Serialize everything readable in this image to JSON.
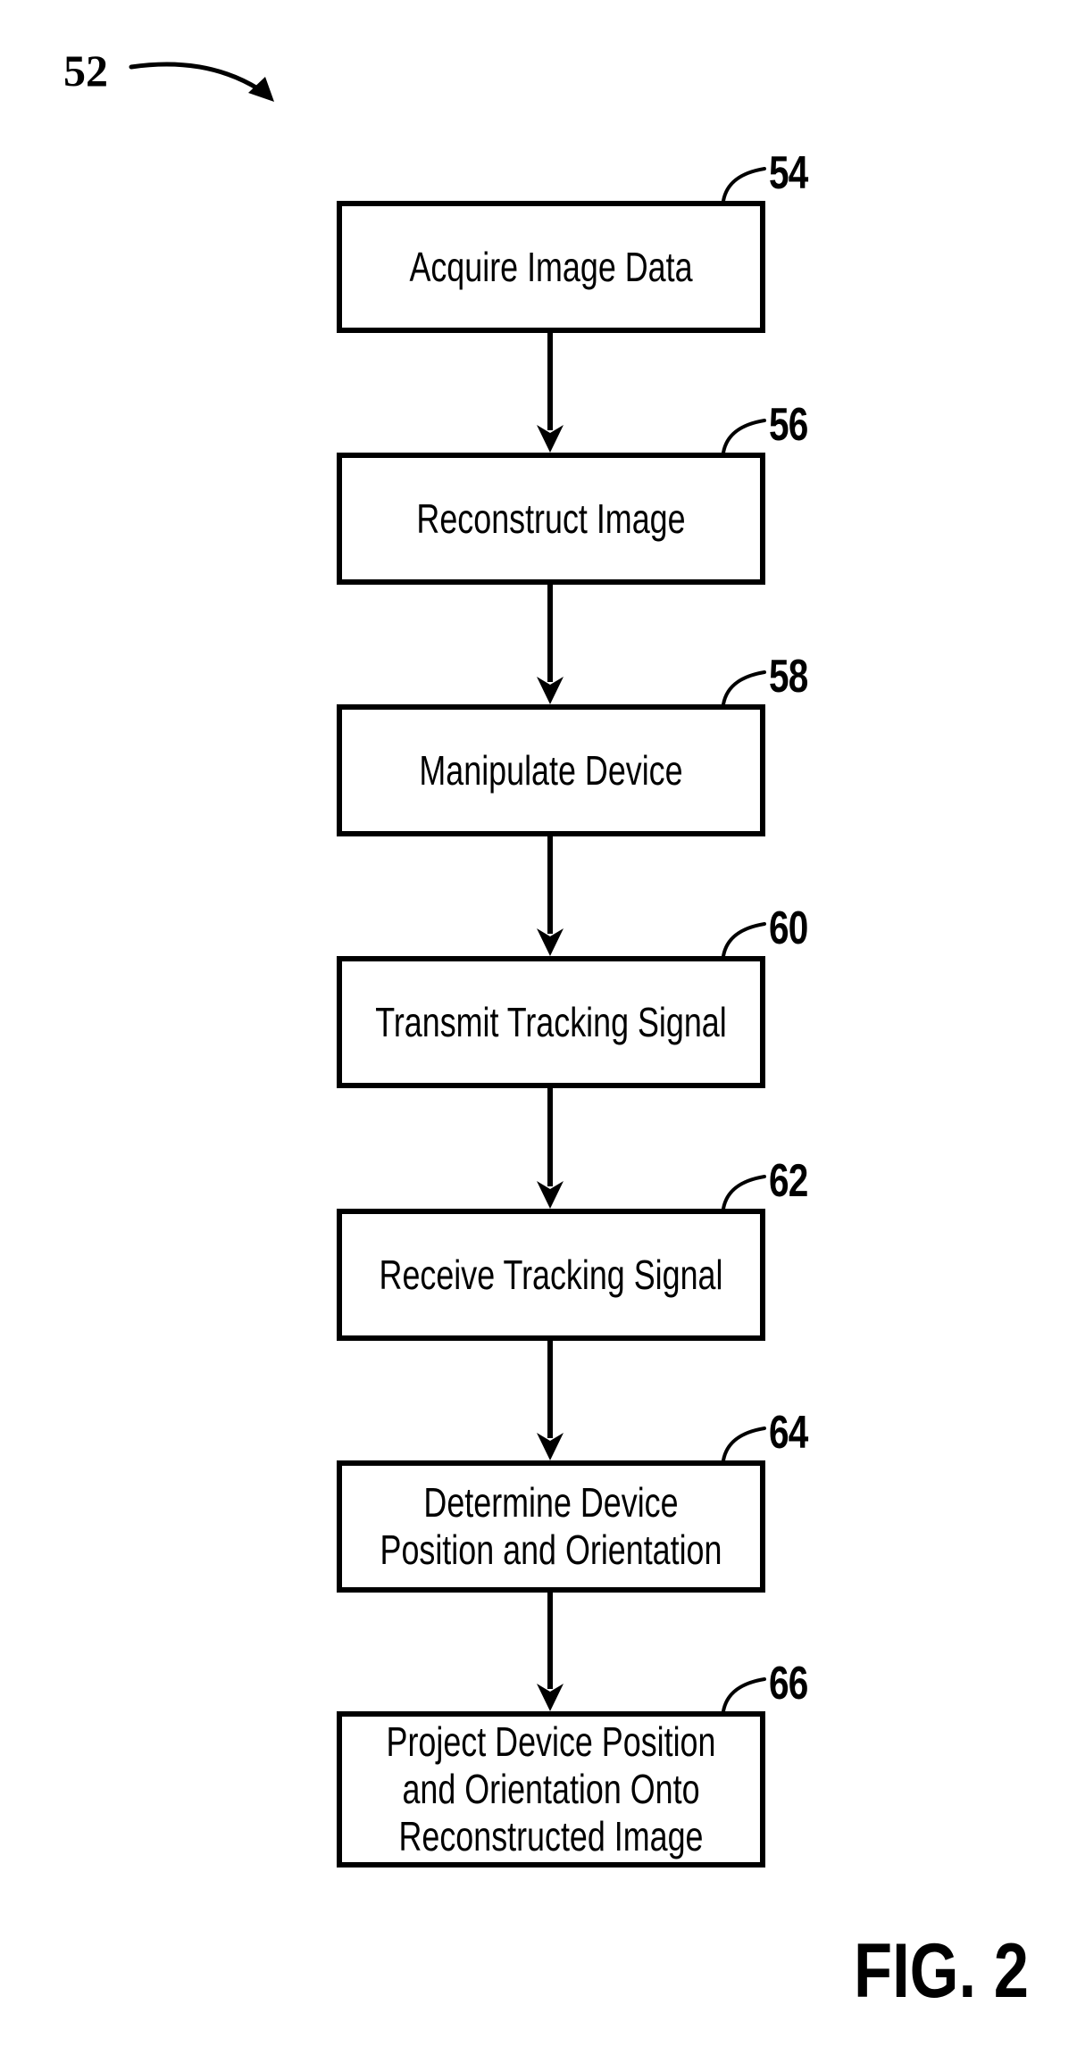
{
  "figure": {
    "reference_numeral": "52",
    "caption": "FIG. 2"
  },
  "steps": [
    {
      "ref": "54",
      "label": "Acquire Image Data"
    },
    {
      "ref": "56",
      "label": "Reconstruct Image"
    },
    {
      "ref": "58",
      "label": "Manipulate Device"
    },
    {
      "ref": "60",
      "label": "Transmit Tracking Signal"
    },
    {
      "ref": "62",
      "label": "Receive Tracking Signal"
    },
    {
      "ref": "64",
      "label": "Determine Device\nPosition and Orientation"
    },
    {
      "ref": "66",
      "label": "Project Device Position\nand Orientation Onto\nReconstructed Image"
    }
  ],
  "colors": {
    "ink": "#000000",
    "paper": "#ffffff"
  }
}
